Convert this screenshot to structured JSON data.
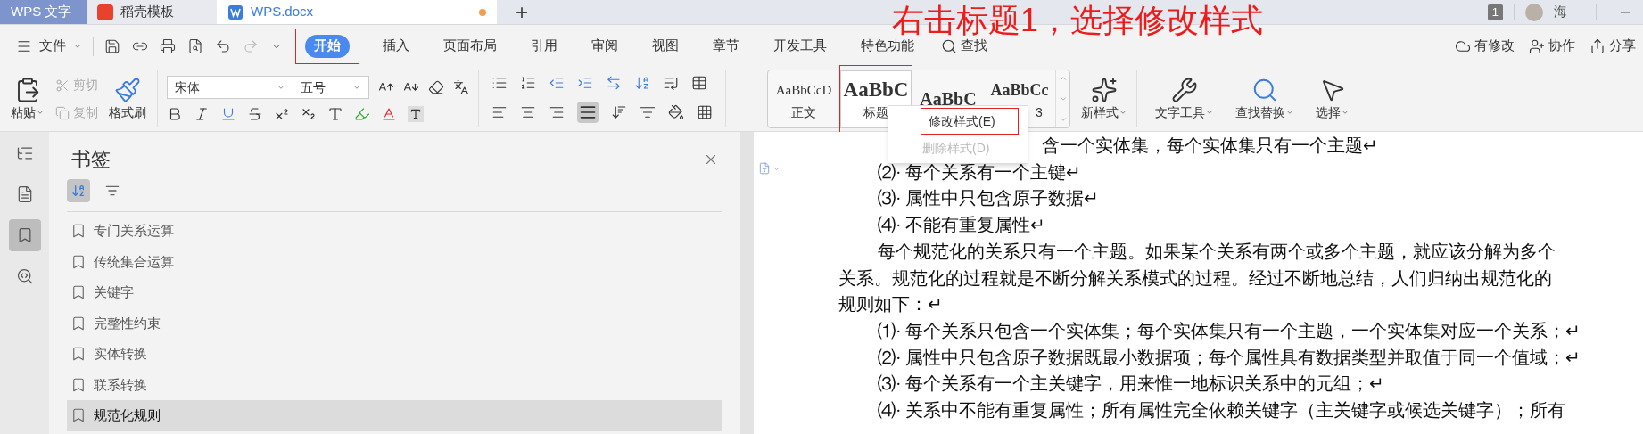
{
  "annotation": "右击标题1，选择修改样式",
  "title_bar": {
    "tabs": [
      {
        "kind": "app",
        "label": "WPS 文字",
        "selected": false
      },
      {
        "kind": "template",
        "label": "稻壳模板",
        "selected": false
      },
      {
        "kind": "doc",
        "label": "WPS.docx",
        "selected": true,
        "unsaved": true
      }
    ],
    "new_tab": "+",
    "page_count": "1",
    "user": "海"
  },
  "menu": {
    "file": "文件",
    "tabs": [
      {
        "label": "开始",
        "selected": true,
        "highlighted": true
      },
      {
        "label": "插入",
        "selected": false,
        "highlighted": false
      },
      {
        "label": "页面布局",
        "selected": false,
        "highlighted": false
      },
      {
        "label": "引用",
        "selected": false,
        "highlighted": false
      },
      {
        "label": "审阅",
        "selected": false,
        "highlighted": false
      },
      {
        "label": "视图",
        "selected": false,
        "highlighted": false
      },
      {
        "label": "章节",
        "selected": false,
        "highlighted": false
      },
      {
        "label": "开发工具",
        "selected": false,
        "highlighted": false
      },
      {
        "label": "特色功能",
        "selected": false,
        "highlighted": false
      }
    ],
    "search": "查找",
    "actions": [
      {
        "kind": "changes",
        "label": "有修改"
      },
      {
        "kind": "collab",
        "label": "协作"
      },
      {
        "kind": "share",
        "label": "分享"
      }
    ]
  },
  "ribbon": {
    "paste": "粘贴",
    "cut": {
      "label": "剪切",
      "disabled": true
    },
    "copy": {
      "label": "复制",
      "disabled": true
    },
    "painter": "格式刷",
    "font_family": "宋体",
    "font_size": "五号",
    "styles": [
      {
        "kind": "body",
        "preview": "AaBbCcD",
        "label": "正文",
        "selected": false,
        "highlighted": false
      },
      {
        "kind": "title",
        "preview": "AaBbC",
        "label": "标题",
        "selected": true,
        "highlighted": true
      },
      {
        "kind": "heading1",
        "preview": "AaBbC",
        "selected": false,
        "highlighted": false
      },
      {
        "kind": "heading3",
        "preview": "AaBbCc",
        "label": "3",
        "selected": false,
        "highlighted": false
      }
    ],
    "new_style": "新样式",
    "tools": [
      {
        "kind": "text",
        "label": "文字工具"
      },
      {
        "kind": "find",
        "label": "查找替换"
      },
      {
        "kind": "select",
        "label": "选择"
      }
    ]
  },
  "context_menu": {
    "items": [
      {
        "label": "修改样式(E)",
        "disabled": false,
        "highlighted": true
      },
      {
        "label": "删除样式(D)",
        "disabled": true,
        "highlighted": false
      }
    ]
  },
  "rail": [
    {
      "kind": "outline",
      "selected": false
    },
    {
      "kind": "sections",
      "selected": false
    },
    {
      "kind": "bookmarks",
      "selected": true
    },
    {
      "kind": "find",
      "selected": false
    }
  ],
  "sidebar": {
    "title": "书签",
    "sort_modes": [
      {
        "kind": "alpha",
        "selected": true
      },
      {
        "kind": "position",
        "selected": false
      }
    ],
    "bookmarks": [
      {
        "label": "专门关系运算",
        "selected": false
      },
      {
        "label": "传统集合运算",
        "selected": false
      },
      {
        "label": "关键字",
        "selected": false
      },
      {
        "label": "完整性约束",
        "selected": false
      },
      {
        "label": "实体转换",
        "selected": false
      },
      {
        "label": "联系转换",
        "selected": false
      },
      {
        "label": "规范化规则",
        "selected": true
      }
    ]
  },
  "document": {
    "lines": [
      {
        "kind": "covered",
        "text": "含一个实体集，每个实体集只有一个主题↵"
      },
      {
        "kind": "indent",
        "text": "⑵· 每个关系有一个主键↵"
      },
      {
        "kind": "indent",
        "text": "⑶· 属性中只包含原子数据↵"
      },
      {
        "kind": "indent",
        "text": "⑷· 不能有重复属性↵"
      },
      {
        "kind": "indent",
        "text": "每个规范化的关系只有一个主题。如果某个关系有两个或多个主题，就应该分解为多个"
      },
      {
        "kind": "flush",
        "text": "关系。规范化的过程就是不断分解关系模式的过程。经过不断地总结，人们归纳出规范化的"
      },
      {
        "kind": "flush",
        "text": "规则如下：↵"
      },
      {
        "kind": "indent",
        "text": "⑴· 每个关系只包含一个实体集；每个实体集只有一个主题，一个实体集对应一个关系；↵"
      },
      {
        "kind": "indent",
        "text": "⑵· 属性中只包含原子数据既最小数据项；每个属性具有数据类型并取值于同一个值域；↵"
      },
      {
        "kind": "indent",
        "text": "⑶· 每个关系有一个主关键字，用来惟一地标识关系中的元组；↵"
      },
      {
        "kind": "indent",
        "text": "⑷· 关系中不能有重复属性；所有属性完全依赖关键字（主关键字或候选关键字）；所有"
      }
    ]
  }
}
